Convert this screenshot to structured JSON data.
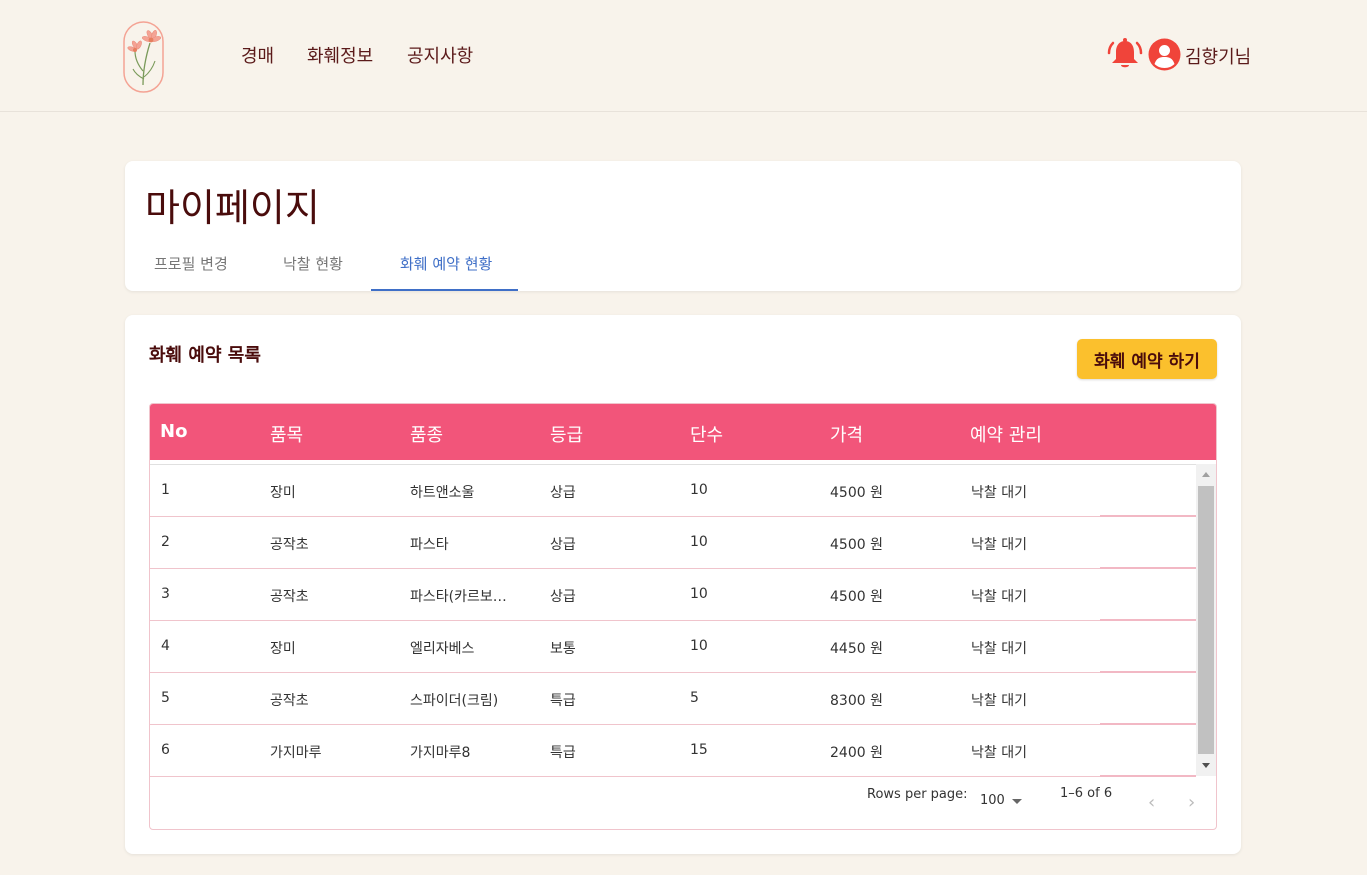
{
  "header": {
    "nav": [
      {
        "label": "경매"
      },
      {
        "label": "화훼정보"
      },
      {
        "label": "공지사항"
      }
    ],
    "username": "김향기님",
    "bell_color": "#f0443a",
    "avatar_color": "#f0443a"
  },
  "title_card": {
    "title": "마이페이지",
    "tabs": [
      {
        "label": "프로필 변경"
      },
      {
        "label": "낙찰 현황"
      },
      {
        "label": "화훼 예약 현황"
      }
    ],
    "active_tab": "화훼 예약 현황"
  },
  "list_card": {
    "title": "화훼 예약 목록",
    "reserve_button": "화훼 예약 하기",
    "columns": [
      "No",
      "품목",
      "품종",
      "등급",
      "단수",
      "가격",
      "예약 관리"
    ],
    "rows": [
      {
        "no": "1",
        "item": "장미",
        "variety": "하트앤소울",
        "grade": "상급",
        "count": "10",
        "price": "4500 원",
        "status": "낙찰 대기"
      },
      {
        "no": "2",
        "item": "공작초",
        "variety": "파스타",
        "grade": "상급",
        "count": "10",
        "price": "4500 원",
        "status": "낙찰 대기"
      },
      {
        "no": "3",
        "item": "공작초",
        "variety": "파스타(카르보…",
        "grade": "상급",
        "count": "10",
        "price": "4500 원",
        "status": "낙찰 대기"
      },
      {
        "no": "4",
        "item": "장미",
        "variety": "엘리자베스",
        "grade": "보통",
        "count": "10",
        "price": "4450 원",
        "status": "낙찰 대기"
      },
      {
        "no": "5",
        "item": "공작초",
        "variety": "스파이더(크림)",
        "grade": "특급",
        "count": "5",
        "price": "8300 원",
        "status": "낙찰 대기"
      },
      {
        "no": "6",
        "item": "가지마루",
        "variety": "가지마루8",
        "grade": "특급",
        "count": "15",
        "price": "2400 원",
        "status": "낙찰 대기"
      }
    ],
    "pagination": {
      "rows_per_page_label": "Rows per page:",
      "rows_per_page": "100",
      "range": "1–6 of 6",
      "prev_icon": "‹",
      "next_icon": "›"
    }
  },
  "colors": {
    "background": "#f8f3eb",
    "header_row": "#f2557a",
    "accent_button": "#fbc02d",
    "active_tab": "#3f6fc7",
    "title_text": "#4a0c0c"
  }
}
